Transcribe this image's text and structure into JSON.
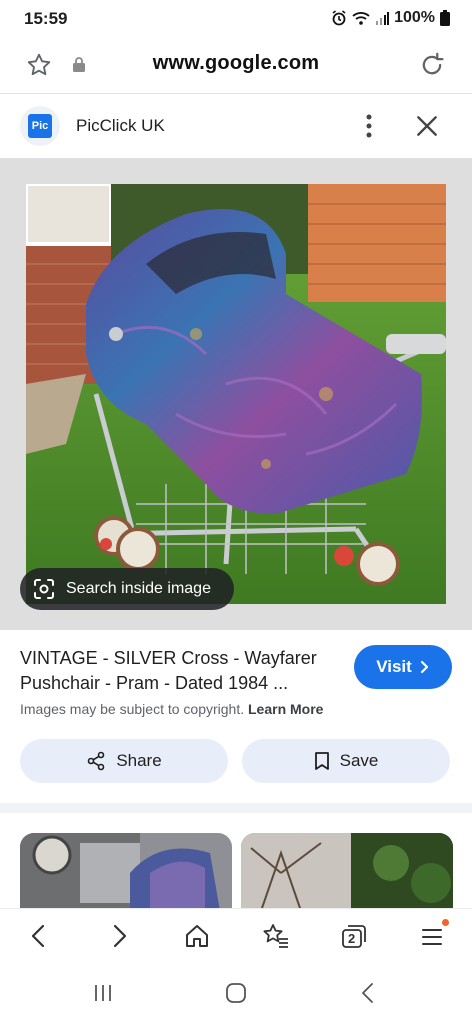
{
  "status_bar": {
    "time": "15:59",
    "battery": "100%",
    "icons": [
      "alarm-icon",
      "wifi-icon",
      "signal-icon",
      "battery-icon"
    ]
  },
  "url_bar": {
    "url": "www.google.com",
    "icons": [
      "star-icon",
      "lock-icon",
      "reload-icon"
    ]
  },
  "site": {
    "logo_text": "Pic",
    "name": "PicClick UK"
  },
  "image": {
    "search_inside_label": "Search inside image",
    "description_colors": [
      "#6b5aa8",
      "#3a6fb0",
      "#8a4c9c"
    ]
  },
  "result": {
    "title": "VINTAGE - SILVER Cross - Wayfarer Pushchair - Pram - Dated 1984 ...",
    "visit_label": "Visit",
    "copyright_text": "Images may be subject to copyright.",
    "learn_more": "Learn More"
  },
  "actions": {
    "share_label": "Share",
    "save_label": "Save"
  },
  "bottom_nav": {
    "tab_count": "2",
    "icons": [
      "back-icon",
      "forward-icon",
      "home-icon",
      "favorites-icon",
      "tabs-icon",
      "menu-icon"
    ]
  },
  "colors": {
    "accent": "#1a73e8",
    "chip_bg": "#e8eef9"
  }
}
